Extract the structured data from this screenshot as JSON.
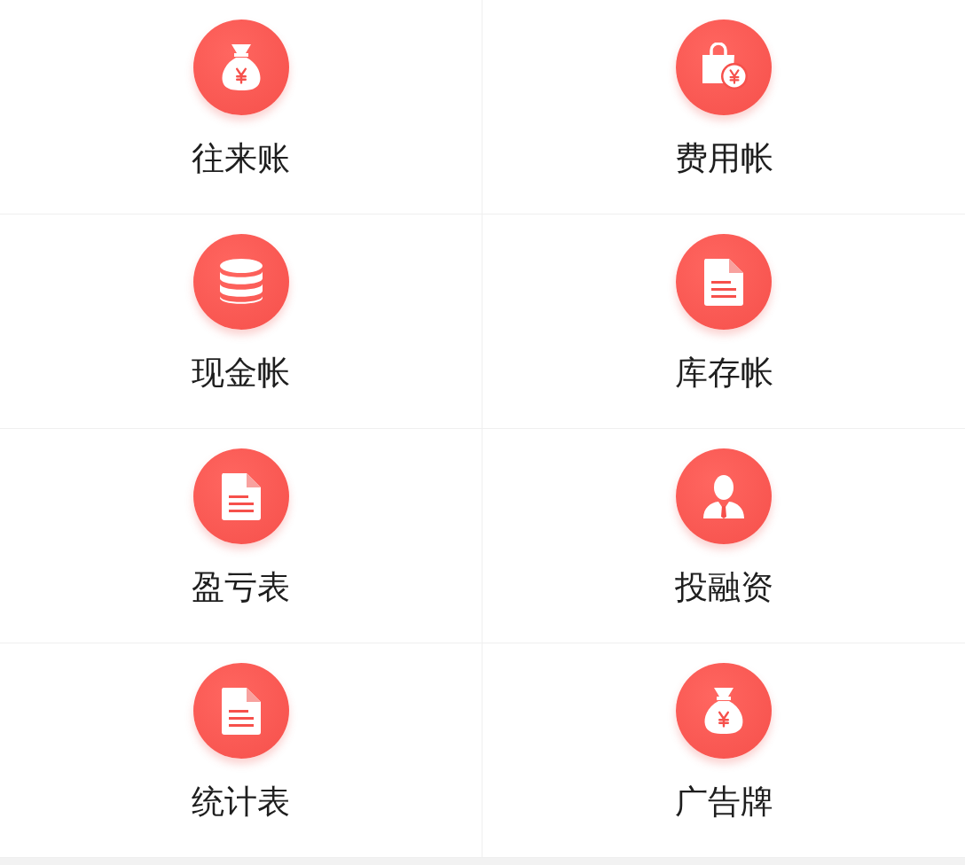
{
  "grid": [
    {
      "label": "往来账",
      "kind": "moneybag"
    },
    {
      "label": "费用帐",
      "kind": "shopping"
    },
    {
      "label": "现金帐",
      "kind": "database"
    },
    {
      "label": "库存帐",
      "kind": "document"
    },
    {
      "label": "盈亏表",
      "kind": "document"
    },
    {
      "label": "投融资",
      "kind": "person"
    },
    {
      "label": "统计表",
      "kind": "document"
    },
    {
      "label": "广告牌",
      "kind": "moneybag"
    }
  ]
}
